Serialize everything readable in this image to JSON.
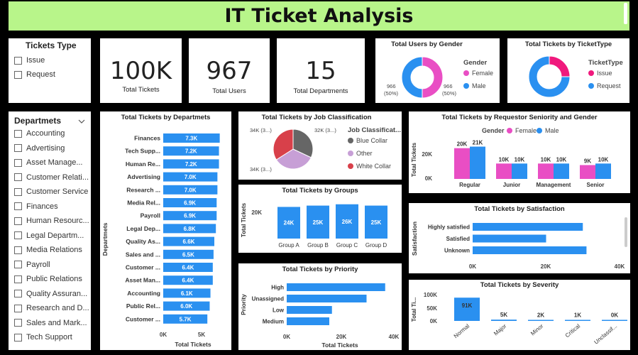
{
  "title": "IT Ticket Analysis",
  "colors": {
    "blue": "#2a90f0",
    "pink": "#e94ec4",
    "magenta": "#f0197d",
    "grey": "#666666",
    "lavender": "#c79fd6",
    "red": "#d8404a",
    "green": "#b8f58a"
  },
  "tickets_type_slicer": {
    "title": "Tickets Type",
    "items": [
      "Issue",
      "Request"
    ]
  },
  "kpis": [
    {
      "value": "100K",
      "label": "Total Tickets"
    },
    {
      "value": "967",
      "label": "Total Users"
    },
    {
      "value": "15",
      "label": "Total Departments"
    }
  ],
  "departments_slicer": {
    "title": "Departmets",
    "items": [
      "Accounting",
      "Advertising",
      "Asset Manage...",
      "Customer Relati...",
      "Customer Service",
      "Finances",
      "Human Resourc...",
      "Legal Departm...",
      "Media Relations",
      "Payroll",
      "Public Relations",
      "Quality Assuran...",
      "Research and D...",
      "Sales and Mark...",
      "Tech Support"
    ]
  },
  "chart_data": [
    {
      "id": "users_by_gender",
      "type": "pie",
      "donut": true,
      "title": "Total Users by Gender",
      "legend_title": "Gender",
      "categories": [
        "Female",
        "Male"
      ],
      "values": [
        966,
        966
      ],
      "data_labels": [
        "966\n(50%)",
        "966\n(50%)"
      ],
      "colors": [
        "#e94ec4",
        "#2a90f0"
      ],
      "legend_position": "right"
    },
    {
      "id": "tickets_by_type",
      "type": "pie",
      "donut": true,
      "title": "Total Tickets by TicketType",
      "legend_title": "TicketType",
      "categories": [
        "Issue",
        "Request"
      ],
      "values": [
        25,
        75
      ],
      "colors": [
        "#f0197d",
        "#2a90f0"
      ],
      "legend_position": "right"
    },
    {
      "id": "tickets_by_department",
      "type": "bar",
      "orientation": "horizontal",
      "title": "Total Tickets by Departmets",
      "xlabel": "Total Tickets",
      "ylabel": "Departmets",
      "categories": [
        "Finances",
        "Tech Supp...",
        "Human Re...",
        "Advertising",
        "Research ...",
        "Media Rel...",
        "Payroll",
        "Legal Dep...",
        "Quality As...",
        "Sales and ...",
        "Customer ...",
        "Asset Man...",
        "Accounting",
        "Public Rel...",
        "Customer ..."
      ],
      "values": [
        7.3,
        7.2,
        7.2,
        7.0,
        7.0,
        6.9,
        6.9,
        6.8,
        6.6,
        6.5,
        6.4,
        6.4,
        6.1,
        6.0,
        5.7
      ],
      "data_labels": [
        "7.3K",
        "7.2K",
        "7.2K",
        "7.0K",
        "7.0K",
        "6.9K",
        "6.9K",
        "6.8K",
        "6.6K",
        "6.5K",
        "6.4K",
        "6.4K",
        "6.1K",
        "6.0K",
        "5.7K"
      ],
      "x_ticks": [
        "0K",
        "5K"
      ],
      "xlim": [
        0,
        7.7
      ],
      "unit": "K"
    },
    {
      "id": "tickets_by_job",
      "type": "pie",
      "title": "Total Tickets by Job Classification",
      "legend_title": "Job Classificat...",
      "categories": [
        "Blue Collar",
        "Other",
        "White Collar"
      ],
      "values": [
        32,
        34,
        34
      ],
      "data_labels": [
        "32K (3...)",
        "34K (3...)",
        "34K (3...)"
      ],
      "colors": [
        "#666666",
        "#c79fd6",
        "#d8404a"
      ],
      "legend_position": "right"
    },
    {
      "id": "tickets_by_groups",
      "type": "bar",
      "title": "Total Tickets by Groups",
      "ylabel": "Total Tickets",
      "categories": [
        "Group A",
        "Group B",
        "Group C",
        "Group D"
      ],
      "values": [
        24,
        25,
        26,
        25
      ],
      "data_labels": [
        "24K",
        "25K",
        "26K",
        "25K"
      ],
      "y_ticks": [
        "20K"
      ],
      "ylim": [
        0,
        28
      ],
      "unit": "K"
    },
    {
      "id": "tickets_by_priority",
      "type": "bar",
      "orientation": "horizontal",
      "title": "Total Tickets by Priority",
      "xlabel": "Total Tickets",
      "ylabel": "Priority",
      "categories": [
        "High",
        "Unassigned",
        "Low",
        "Medium"
      ],
      "values": [
        37,
        30,
        17,
        16
      ],
      "x_ticks": [
        "0K",
        "20K",
        "40K"
      ],
      "xlim": [
        0,
        40
      ],
      "unit": "K"
    },
    {
      "id": "tickets_by_seniority_gender",
      "type": "bar",
      "title": "Total Tickets by Requestor Seniority and Gender",
      "ylabel": "Total Tickets",
      "legend_title": "Gender",
      "categories": [
        "Regular",
        "Junior",
        "Management",
        "Senior"
      ],
      "series": [
        {
          "name": "Female",
          "values": [
            20,
            10,
            10,
            9
          ],
          "data_labels": [
            "20K",
            "10K",
            "10K",
            "9K"
          ],
          "color": "#e94ec4"
        },
        {
          "name": "Male",
          "values": [
            21,
            10,
            10,
            10
          ],
          "data_labels": [
            "21K",
            "10K",
            "10K",
            "10K"
          ],
          "color": "#2a90f0"
        }
      ],
      "y_ticks": [
        "0K",
        "20K"
      ],
      "ylim": [
        0,
        24
      ],
      "legend_position": "top",
      "unit": "K"
    },
    {
      "id": "tickets_by_satisfaction",
      "type": "bar",
      "orientation": "horizontal",
      "title": "Total Tickets by Satisfaction",
      "ylabel": "Satisfaction",
      "categories": [
        "Highly satisfied",
        "Satisfied",
        "Unknown"
      ],
      "values": [
        30,
        20,
        31
      ],
      "x_ticks": [
        "0K",
        "20K",
        "40K"
      ],
      "xlim": [
        0,
        40
      ],
      "unit": "K"
    },
    {
      "id": "tickets_by_severity",
      "type": "bar",
      "title": "Total Tickets by Severity",
      "ylabel": "Total Ti...",
      "categories": [
        "Normal",
        "Major",
        "Minor",
        "Critical",
        "Unclassif..."
      ],
      "values": [
        91,
        5,
        2,
        1,
        0.3
      ],
      "data_labels": [
        "91K",
        "5K",
        "2K",
        "1K",
        "0K"
      ],
      "y_ticks": [
        "0K",
        "50K",
        "100K"
      ],
      "ylim": [
        0,
        100
      ],
      "unit": "K"
    }
  ]
}
